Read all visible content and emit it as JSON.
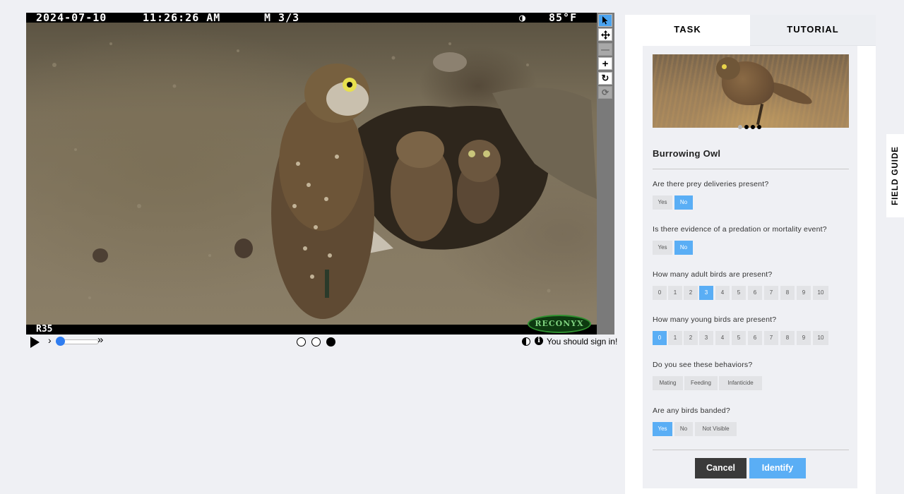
{
  "camera": {
    "date": "2024-07-10",
    "time": "11:26:26 AM",
    "frame": "M 3/3",
    "moon": "◑",
    "temperature": "85°F",
    "camera_id": "R35",
    "brand": "RECONYX"
  },
  "toolbar": {
    "select_icon": "arrow-pointer-icon",
    "move_icon": "move-arrows-icon",
    "zoom_out_icon": "minus-icon",
    "zoom_in_icon": "plus-icon",
    "rotate_icon": "rotate-icon",
    "reset_icon": "reset-icon"
  },
  "playback": {
    "slow_symbol": "›",
    "fast_symbol": "»",
    "frame_count": 3,
    "active_frame": 3,
    "sign_in_text": "You should sign in!"
  },
  "tabs": {
    "task": "TASK",
    "tutorial": "TUTORIAL"
  },
  "species_card": {
    "name": "Burrowing Owl",
    "image_count": 4,
    "active_image": 2
  },
  "questions": [
    {
      "text": "Are there prey deliveries present?",
      "options": [
        "Yes",
        "No"
      ],
      "selected": "No"
    },
    {
      "text": "Is there evidence of a predation or mortality event?",
      "options": [
        "Yes",
        "No"
      ],
      "selected": "No"
    },
    {
      "text": "How many adult birds are present?",
      "options": [
        "0",
        "1",
        "2",
        "3",
        "4",
        "5",
        "6",
        "7",
        "8",
        "9",
        "10"
      ],
      "selected": "3"
    },
    {
      "text": "How many young birds are present?",
      "options": [
        "0",
        "1",
        "2",
        "3",
        "4",
        "5",
        "6",
        "7",
        "8",
        "9",
        "10"
      ],
      "selected": "0"
    },
    {
      "text": "Do you see these behaviors?",
      "options": [
        "Mating",
        "Feeding",
        "Infanticide"
      ],
      "selected": null
    },
    {
      "text": "Are any birds banded?",
      "options": [
        "Yes",
        "No",
        "Not Visible"
      ],
      "selected": "Yes"
    }
  ],
  "actions": {
    "cancel": "Cancel",
    "identify": "Identify"
  },
  "field_guide": {
    "label": "FIELD GUIDE"
  },
  "colors": {
    "accent": "#5aaef5",
    "dark_button": "#3a3a3a",
    "background": "#eff0f4"
  }
}
